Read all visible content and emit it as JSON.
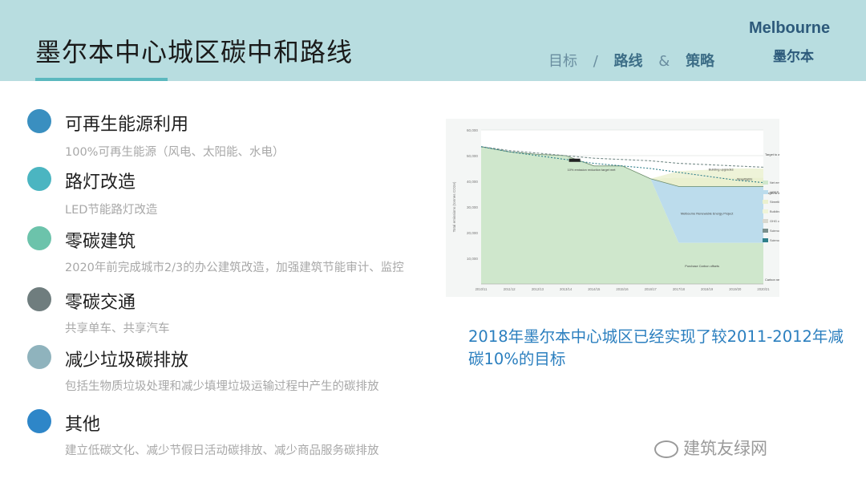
{
  "header": {
    "title": "墨尔本中心城区碳中和路线",
    "nav": {
      "goal": "目标",
      "sep1": "/",
      "route": "路线",
      "sep2": "&",
      "strategy": "策略"
    },
    "brand_en": "Melbourne",
    "brand_cn": "墨尔本"
  },
  "items": [
    {
      "title": "可再生能源利用",
      "desc": "100%可再生能源（风电、太阳能、水电）",
      "color": "#3a8fc0"
    },
    {
      "title": "路灯改造",
      "desc": "LED节能路灯改造",
      "color": "#4bb5c1"
    },
    {
      "title": "零碳建筑",
      "desc": "2020年前完成城市2/3的办公建筑改造，加强建筑节能审计、监控",
      "color": "#6cc3ab"
    },
    {
      "title": "零碳交通",
      "desc": "共享单车、共享汽车",
      "color": "#6f7d7e"
    },
    {
      "title": "减少垃圾碳排放",
      "desc": "包括生物质垃圾处理和减少填埋垃圾运输过程中产生的碳排放",
      "color": "#8fb3bd"
    },
    {
      "title": "其他",
      "desc": "建立低碳文化、减少节假日活动碳排放、减少商品服务碳排放",
      "color": "#2e86c8"
    }
  ],
  "caption": "2018年墨尔本中心城区已经实现了较2011-2012年减碳10%的目标",
  "watermark": "建筑友绿网",
  "chart_data": {
    "type": "area",
    "ylabel": "Total emissions (tonnes CO2e)",
    "ylim": [
      0,
      60000
    ],
    "yticks": [
      "60,000",
      "50,000",
      "40,000",
      "30,000",
      "20,000",
      "10,000"
    ],
    "x": [
      "2010/11",
      "2011/12",
      "2012/13",
      "2013/14",
      "2014/15",
      "2015/16",
      "2016/17",
      "2017/18",
      "2018/19",
      "2019/20",
      "2020/21"
    ],
    "series": [
      {
        "name": "Net emissions (offset)",
        "values": [
          53500,
          51500,
          50500,
          50000,
          46000,
          46000,
          41000,
          38000,
          38000,
          38000,
          38000
        ],
        "color": "#cfe7cc"
      },
      {
        "name": "MREP",
        "values": [
          null,
          null,
          null,
          null,
          null,
          null,
          41000,
          16000,
          16000,
          16000,
          16000
        ],
        "color": "#bcdcec"
      },
      {
        "name": "Streetlights",
        "values": [
          null,
          null,
          null,
          null,
          null,
          null,
          41000,
          41500,
          41500,
          41500,
          41500
        ],
        "color": "#eaf0cf"
      },
      {
        "name": "Building upgrades",
        "values": [
          null,
          null,
          null,
          null,
          null,
          null,
          41000,
          44000,
          44500,
          45000,
          45000
        ],
        "color": "#eef3d8"
      },
      {
        "name": "Science based target (2°C)",
        "values": [
          53500,
          52000,
          51000,
          50000,
          49000,
          48500,
          48000,
          47000,
          46500,
          46000,
          45500
        ],
        "color": "#7a8f8c"
      },
      {
        "name": "Science based target (1.5°C) met",
        "values": [
          53500,
          51500,
          50000,
          48500,
          47000,
          46000,
          45000,
          43500,
          42000,
          40500,
          39500
        ],
        "color": "#2f7f8a"
      }
    ],
    "legend": [
      "Net emissions (offset)",
      "MREP",
      "Streetlights",
      "Building upgrades",
      "GHG carbon neutrality",
      "Science based target (2°C)",
      "Science based target (1.5°C) met"
    ],
    "annotations": {
      "target_2deg": "Target to avoid 2 degree C rise in global temperature",
      "target_15deg": "Target to avoid 1.5 degree C rise in global temperature",
      "reduction": "10% emission reduction target met",
      "building": "Building upgrades",
      "streetlights": "Streetlights",
      "mrep": "Melbourne Renewable Energy Project",
      "offsets": "Purchase Carbon offsets",
      "neutral": "Carbon neutral target"
    }
  }
}
